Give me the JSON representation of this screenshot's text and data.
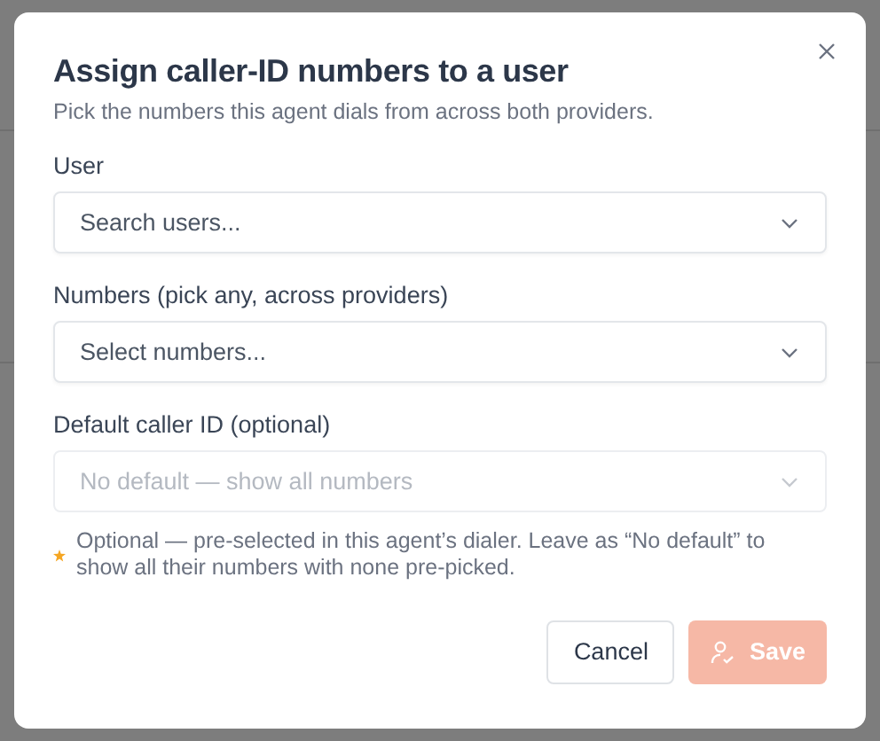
{
  "dialog": {
    "title": "Assign caller-ID numbers to a user",
    "subtitle": "Pick the numbers this agent dials from across both providers.",
    "fields": [
      {
        "label": "User",
        "placeholder": "Search users...",
        "disabled": false
      },
      {
        "label": "Numbers (pick any, across providers)",
        "placeholder": "Select numbers...",
        "disabled": false
      },
      {
        "label": "Default caller ID (optional)",
        "placeholder": "No default — show all numbers",
        "disabled": true
      }
    ],
    "hint": "Optional — pre-selected in this agent’s dialer. Leave as “No default” to show all their numbers with none pre-picked.",
    "buttons": [
      {
        "label": "Cancel",
        "kind": "secondary",
        "disabled": false
      },
      {
        "label": "Save",
        "kind": "primary",
        "disabled": true
      }
    ]
  }
}
